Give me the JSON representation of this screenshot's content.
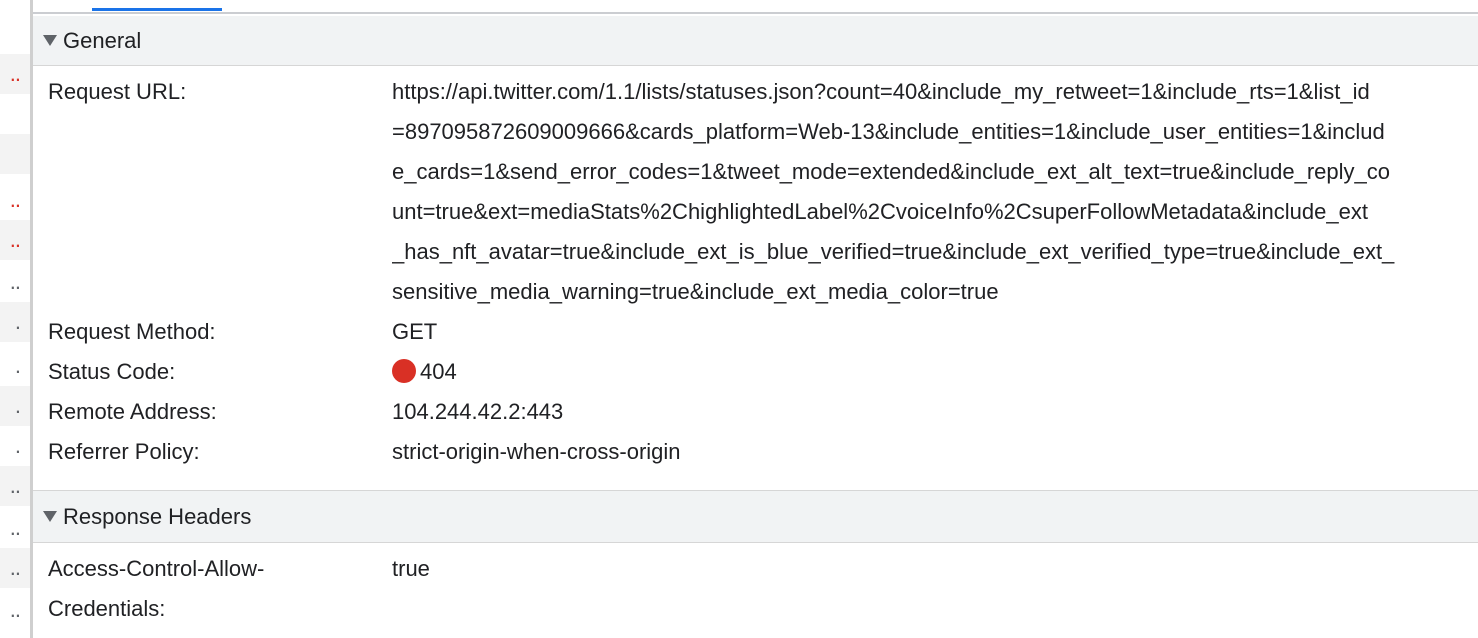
{
  "general": {
    "header": "General",
    "fields": {
      "request_url": {
        "label": "Request URL:",
        "lines": [
          "https://api.twitter.com/1.1/lists/statuses.json?count=40&include_my_retweet=1&include_rts=1&list_id",
          "=897095872609009666&cards_platform=Web-13&include_entities=1&include_user_entities=1&includ",
          "e_cards=1&send_error_codes=1&tweet_mode=extended&include_ext_alt_text=true&include_reply_co",
          "unt=true&ext=mediaStats%2ChighlightedLabel%2CvoiceInfo%2CsuperFollowMetadata&include_ext",
          "_has_nft_avatar=true&include_ext_is_blue_verified=true&include_ext_verified_type=true&include_ext_",
          "sensitive_media_warning=true&include_ext_media_color=true"
        ]
      },
      "request_method": {
        "label": "Request Method:",
        "value": "GET"
      },
      "status_code": {
        "label": "Status Code:",
        "value": "404",
        "status_color": "#d93025"
      },
      "remote_address": {
        "label": "Remote Address:",
        "value": "104.244.42.2:443"
      },
      "referrer_policy": {
        "label": "Referrer Policy:",
        "value": "strict-origin-when-cross-origin"
      }
    }
  },
  "response_headers": {
    "header": "Response Headers",
    "fields": [
      {
        "label_lines": [
          "Access-Control-Allow-",
          "Credentials:"
        ],
        "value": "true"
      }
    ]
  },
  "left_list": {
    "rows": [
      {
        "marker": "..",
        "color": "red"
      },
      {
        "marker": "",
        "color": "none"
      },
      {
        "marker": "",
        "color": "none"
      },
      {
        "marker": "..",
        "color": "red"
      },
      {
        "marker": "..",
        "color": "red"
      },
      {
        "marker": "..",
        "color": "gray"
      },
      {
        "marker": ".",
        "color": "gray"
      },
      {
        "marker": ".",
        "color": "gray"
      },
      {
        "marker": ".",
        "color": "gray"
      },
      {
        "marker": ".",
        "color": "gray"
      },
      {
        "marker": "..",
        "color": "gray"
      },
      {
        "marker": "..",
        "color": "gray"
      },
      {
        "marker": "..",
        "color": "gray"
      },
      {
        "marker": "..",
        "color": "gray"
      }
    ]
  }
}
